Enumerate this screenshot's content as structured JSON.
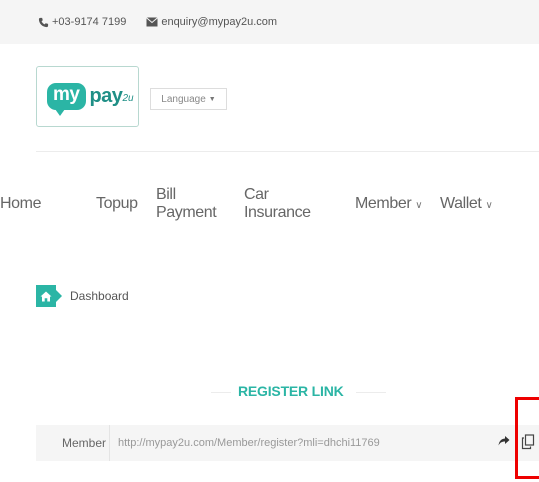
{
  "topbar": {
    "phone": "+03-9174 7199",
    "email": "enquiry@mypay2u.com"
  },
  "logo": {
    "my": "my",
    "pay": "pay",
    "tail": "2u"
  },
  "language": {
    "label": "Language"
  },
  "nav": {
    "items": [
      {
        "label": "Home"
      },
      {
        "label": "Topup"
      },
      {
        "label": "Bill Payment"
      },
      {
        "label": "Car Insurance"
      },
      {
        "label": "Member"
      },
      {
        "label": "Wallet"
      }
    ]
  },
  "breadcrumb": {
    "label": "Dashboard"
  },
  "register": {
    "title": "REGISTER LINK",
    "prefix": "Member",
    "url": "http://mypay2u.com/Member/register?mli=dhchi11769"
  },
  "colors": {
    "accent": "#2bb5a5",
    "highlight": "#ee0000"
  }
}
